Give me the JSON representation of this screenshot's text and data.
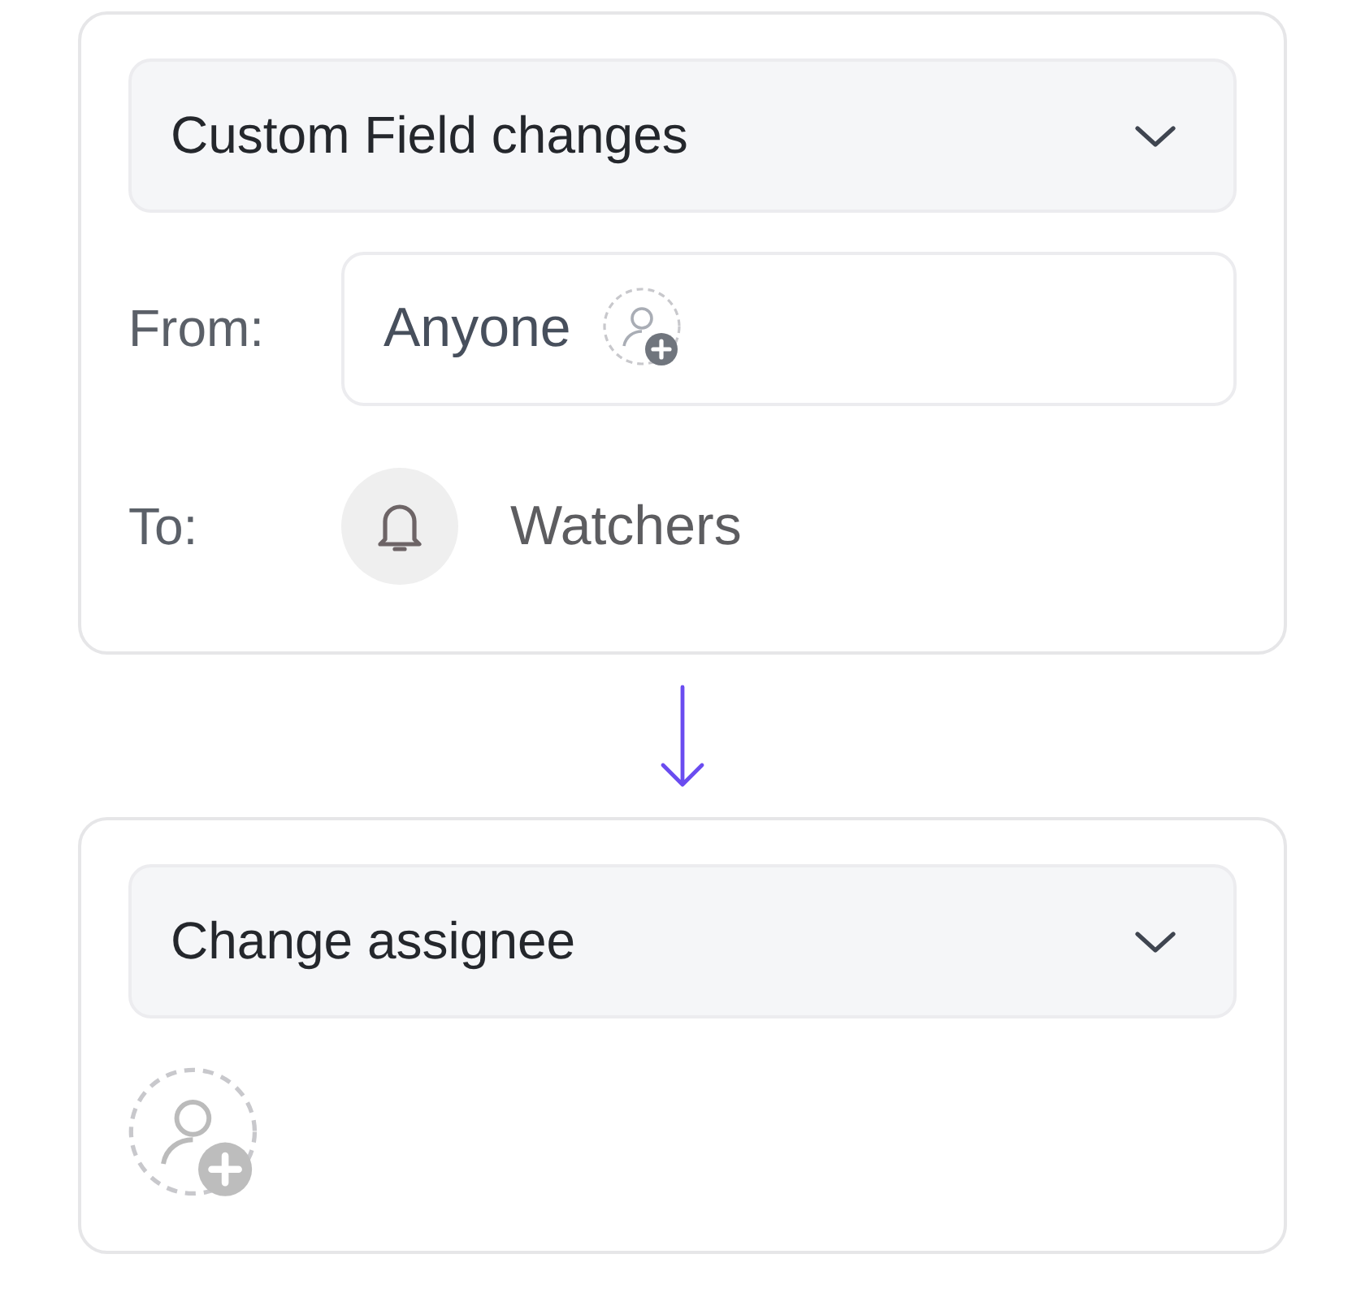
{
  "trigger": {
    "dropdown": {
      "label": "Custom Field changes"
    },
    "from": {
      "label": "From:",
      "value": "Anyone"
    },
    "to": {
      "label": "To:",
      "value": "Watchers"
    }
  },
  "action": {
    "dropdown": {
      "label": "Change assignee"
    }
  }
}
